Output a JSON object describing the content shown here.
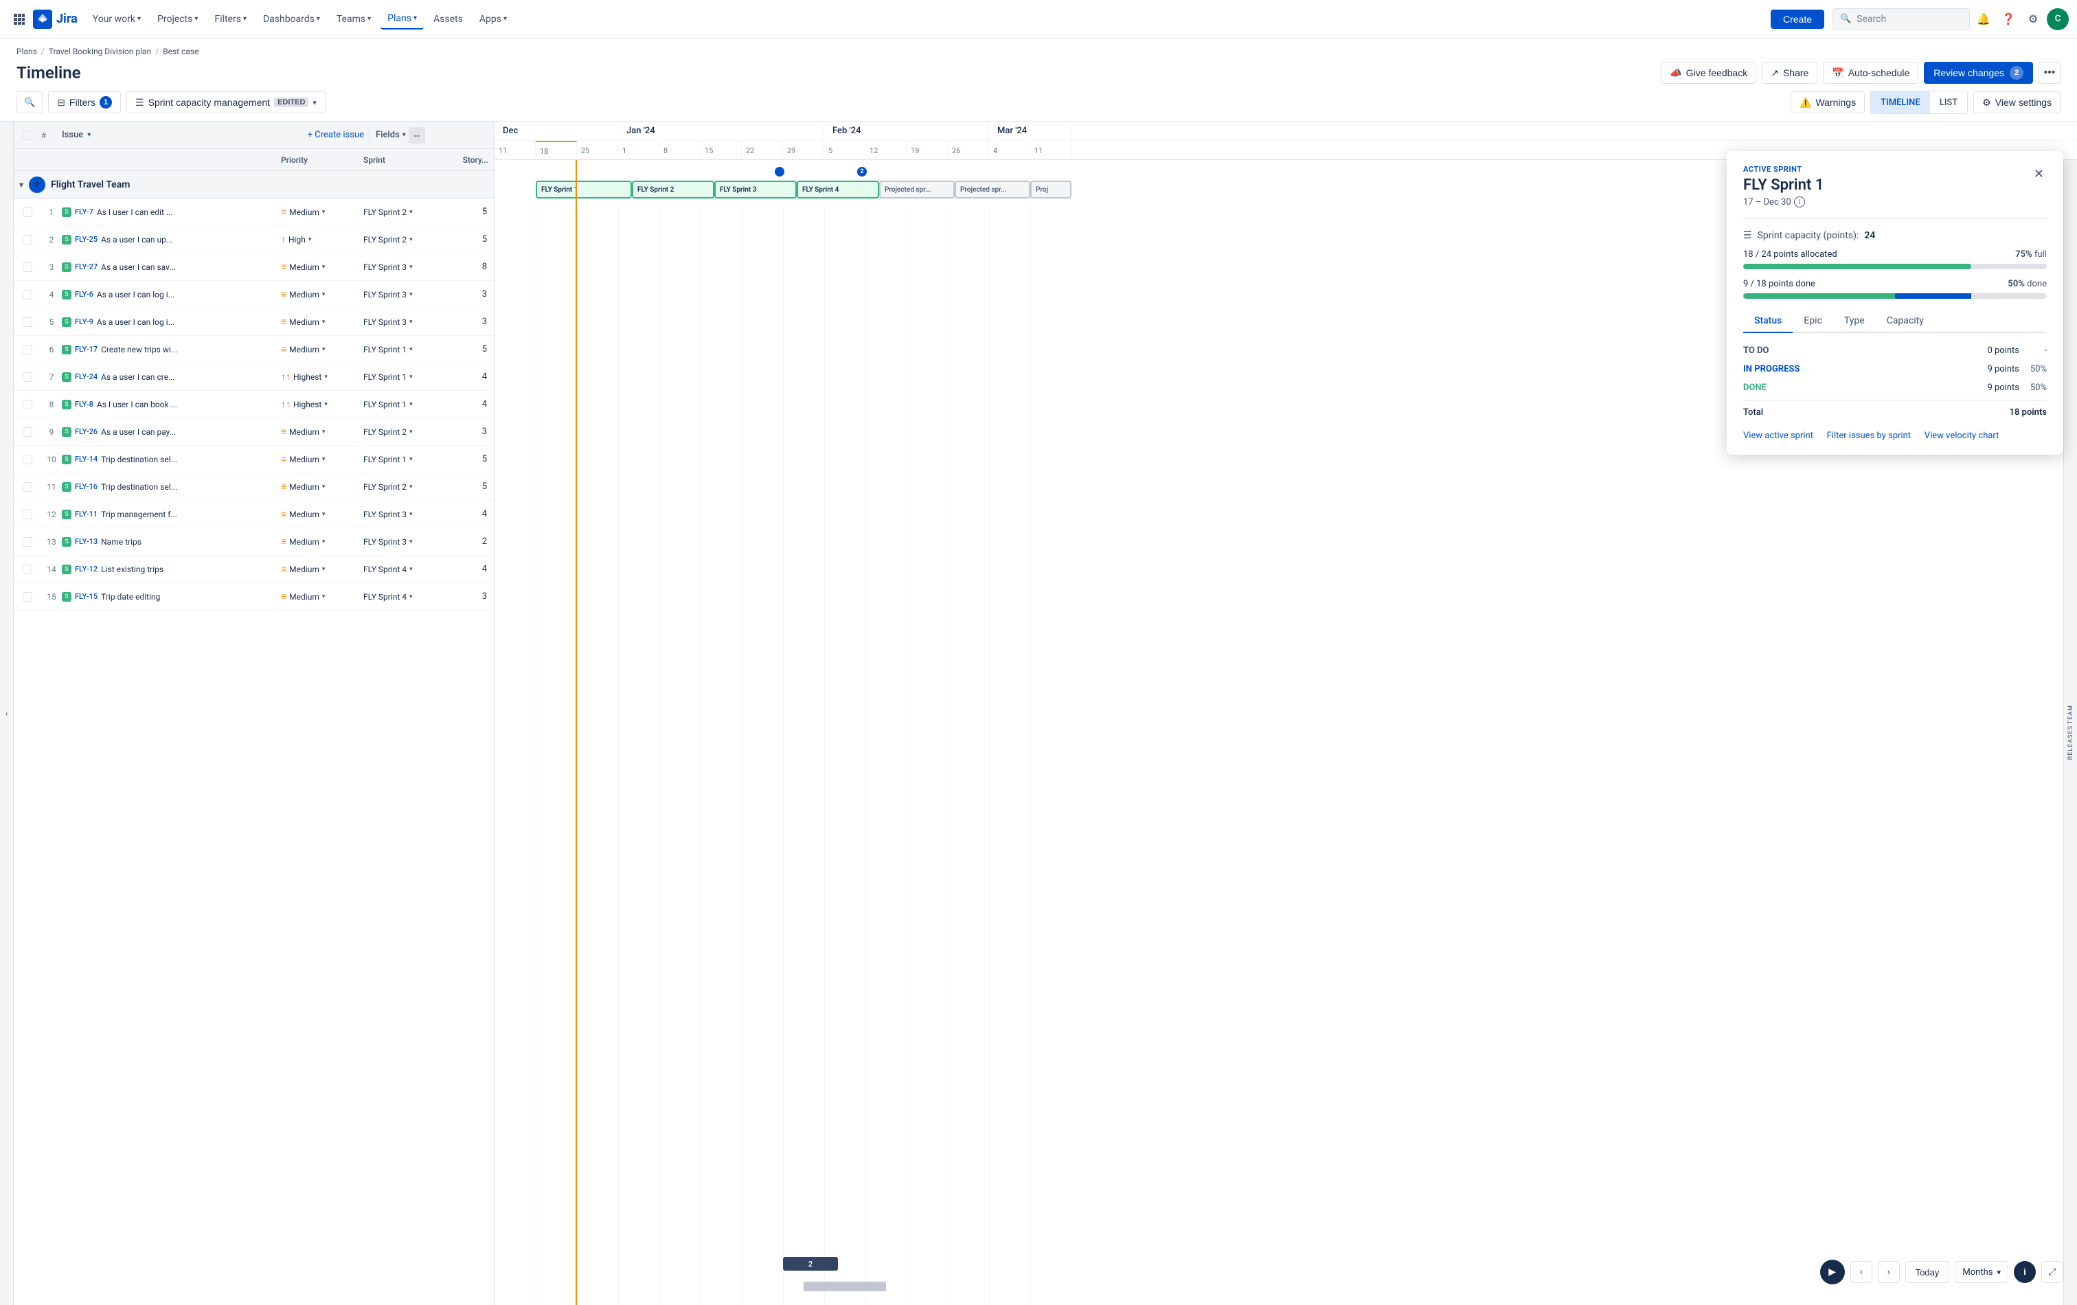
{
  "nav": {
    "logo_text": "Jira",
    "items": [
      {
        "label": "Your work",
        "has_chevron": true
      },
      {
        "label": "Projects",
        "has_chevron": true
      },
      {
        "label": "Filters",
        "has_chevron": true
      },
      {
        "label": "Dashboards",
        "has_chevron": true
      },
      {
        "label": "Teams",
        "has_chevron": true
      },
      {
        "label": "Plans",
        "has_chevron": true,
        "active": true
      },
      {
        "label": "Assets",
        "has_chevron": false
      }
    ],
    "apps": {
      "label": "Apps",
      "has_chevron": true
    },
    "create": "Create",
    "search_placeholder": "Search",
    "avatar_text": "C"
  },
  "breadcrumb": {
    "items": [
      "Plans",
      "Travel Booking Division plan",
      "Best case"
    ]
  },
  "page_title": "Timeline",
  "header_actions": {
    "give_feedback": "Give feedback",
    "share": "Share",
    "auto_schedule": "Auto-schedule",
    "review_changes": "Review changes",
    "review_count": "2"
  },
  "toolbar": {
    "filters_label": "Filters",
    "filters_count": "1",
    "sprint_label": "Sprint capacity management",
    "sprint_edited": "EDITED",
    "warnings_label": "Warnings",
    "timeline_label": "TIMELINE",
    "list_label": "LIST",
    "view_settings": "View settings"
  },
  "table": {
    "columns": {
      "issue": "Issue",
      "create_issue": "+ Create issue",
      "fields": "Fields",
      "priority": "Priority",
      "sprint": "Sprint",
      "story": "Story..."
    },
    "team": {
      "name": "Flight Travel Team",
      "icon": "✈"
    },
    "rows": [
      {
        "num": 1,
        "id": "FLY-7",
        "summary": "As I user I can edit ...",
        "priority": "Medium",
        "sprint": "FLY Sprint 2",
        "story": 5
      },
      {
        "num": 2,
        "id": "FLY-25",
        "summary": "As a user I can up...",
        "priority": "High",
        "sprint": "FLY Sprint 2",
        "story": 5
      },
      {
        "num": 3,
        "id": "FLY-27",
        "summary": "As a user I can sav...",
        "priority": "Medium",
        "sprint": "FLY Sprint 3",
        "story": 8
      },
      {
        "num": 4,
        "id": "FLY-6",
        "summary": "As a user I can log i...",
        "priority": "Medium",
        "sprint": "FLY Sprint 3",
        "story": 3
      },
      {
        "num": 5,
        "id": "FLY-9",
        "summary": "As a user I can log i...",
        "priority": "Medium",
        "sprint": "FLY Sprint 3",
        "story": 3
      },
      {
        "num": 6,
        "id": "FLY-17",
        "summary": "Create new trips wi...",
        "priority": "Medium",
        "sprint": "FLY Sprint 1",
        "story": 5
      },
      {
        "num": 7,
        "id": "FLY-24",
        "summary": "As a user I can cre...",
        "priority": "Highest",
        "sprint": "FLY Sprint 1",
        "story": 4
      },
      {
        "num": 8,
        "id": "FLY-8",
        "summary": "As I user I can book ...",
        "priority": "Highest",
        "sprint": "FLY Sprint 1",
        "story": 4
      },
      {
        "num": 9,
        "id": "FLY-26",
        "summary": "As a user I can pay...",
        "priority": "Medium",
        "sprint": "FLY Sprint 2",
        "story": 3
      },
      {
        "num": 10,
        "id": "FLY-14",
        "summary": "Trip destination sel...",
        "priority": "Medium",
        "sprint": "FLY Sprint 1",
        "story": 5
      },
      {
        "num": 11,
        "id": "FLY-16",
        "summary": "Trip destination sel...",
        "priority": "Medium",
        "sprint": "FLY Sprint 2",
        "story": 5
      },
      {
        "num": 12,
        "id": "FLY-11",
        "summary": "Trip management f...",
        "priority": "Medium",
        "sprint": "FLY Sprint 3",
        "story": 4
      },
      {
        "num": 13,
        "id": "FLY-13",
        "summary": "Name trips",
        "priority": "Medium",
        "sprint": "FLY Sprint 3",
        "story": 2
      },
      {
        "num": 14,
        "id": "FLY-12",
        "summary": "List existing trips",
        "priority": "Medium",
        "sprint": "FLY Sprint 4",
        "story": 4
      },
      {
        "num": 15,
        "id": "FLY-15",
        "summary": "Trip date editing",
        "priority": "Medium",
        "sprint": "FLY Sprint 4",
        "story": 3
      }
    ]
  },
  "timeline": {
    "months": [
      {
        "label": "Dec",
        "weeks": [
          "11",
          "18",
          "25"
        ]
      },
      {
        "label": "Jan '24",
        "weeks": [
          "1",
          "8",
          "15",
          "22",
          "29"
        ]
      },
      {
        "label": "Feb '24",
        "weeks": [
          "5",
          "12",
          "19",
          "26"
        ]
      },
      {
        "label": "Mar '24",
        "weeks": [
          "4",
          "11"
        ]
      }
    ],
    "sprints": [
      {
        "label": "FLY Sprint 1",
        "type": "active"
      },
      {
        "label": "FLY Sprint 2",
        "type": "active"
      },
      {
        "label": "FLY Sprint 3",
        "type": "active"
      },
      {
        "label": "FLY Sprint 4",
        "type": "active"
      },
      {
        "label": "Projected spr...",
        "type": "projected"
      },
      {
        "label": "Projected spr...",
        "type": "projected"
      },
      {
        "label": "Proj",
        "type": "projected"
      }
    ]
  },
  "sprint_popup": {
    "active_sprint_label": "ACTIVE SPRINT",
    "sprint_name": "FLY Sprint 1",
    "dates": "17 – Dec 30",
    "capacity_label": "Sprint capacity (points):",
    "capacity_value": "24",
    "allocated_text": "18 / 24 points allocated",
    "allocated_pct": "75%",
    "allocated_pct_label": "full",
    "allocated_bar_pct": 75,
    "allocated_bar_color": "#36B37E",
    "done_text": "9 / 18 points done",
    "done_pct": "50%",
    "done_pct_label": "done",
    "done_bar_green_pct": 50,
    "done_bar_blue_pct": 25,
    "tabs": [
      "Status",
      "Epic",
      "Type",
      "Capacity"
    ],
    "active_tab": "Status",
    "status_rows": [
      {
        "label": "TO DO",
        "type": "todo",
        "points": "0 points",
        "pct": "-"
      },
      {
        "label": "IN PROGRESS",
        "type": "progress",
        "points": "9 points",
        "pct": "50%"
      },
      {
        "label": "DONE",
        "type": "done",
        "points": "9 points",
        "pct": "50%"
      },
      {
        "label": "Total",
        "type": "total",
        "points": "18 points",
        "pct": ""
      }
    ],
    "footer_links": [
      "View active sprint",
      "Filter issues by sprint",
      "View velocity chart"
    ]
  },
  "bottom_controls": {
    "today": "Today",
    "months": "Months"
  },
  "colors": {
    "blue": "#0052CC",
    "green": "#36B37E",
    "orange": "#FF8B00",
    "gray_border": "#DFE1E6",
    "bg_light": "#F4F5F7"
  }
}
